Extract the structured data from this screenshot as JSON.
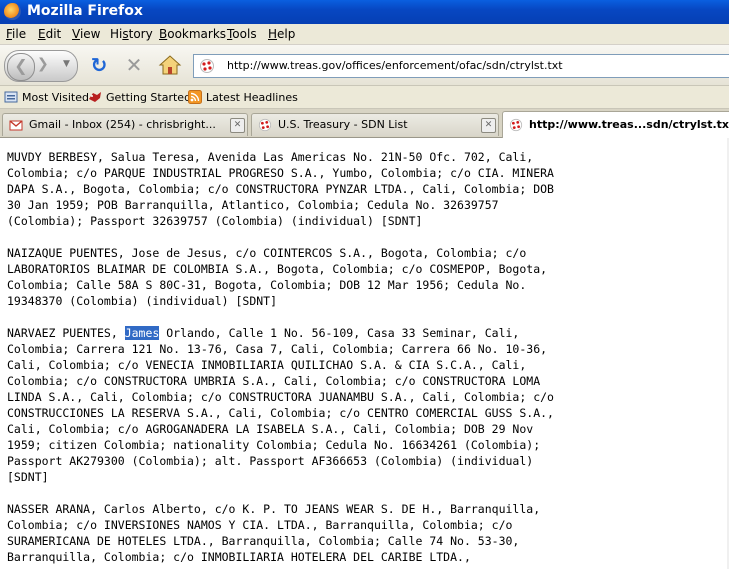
{
  "window": {
    "title": "Mozilla Firefox"
  },
  "menu": [
    "File",
    "Edit",
    "View",
    "History",
    "Bookmarks",
    "Tools",
    "Help"
  ],
  "menu_underline": [
    "F",
    "E",
    "V",
    "s",
    "B",
    "T",
    "H"
  ],
  "address": {
    "url": "http://www.treas.gov/offices/enforcement/ofac/sdn/ctrylst.txt"
  },
  "bookmarks": [
    {
      "label": "Most Visited",
      "icon": "most-visited-icon"
    },
    {
      "label": "Getting Started",
      "icon": "getting-started-icon"
    },
    {
      "label": "Latest Headlines",
      "icon": "rss-feed-icon"
    }
  ],
  "tabs": [
    {
      "label": "Gmail - Inbox (254) - chrisbright...",
      "icon": "gmail-icon",
      "active": false
    },
    {
      "label": "U.S. Treasury - SDN List",
      "icon": "treasury-favicon-icon",
      "active": false
    },
    {
      "label": "http://www.treas...sdn/ctrylst.txt",
      "icon": "treasury-favicon-icon",
      "active": true
    }
  ],
  "content": {
    "entries": [
      [
        "MUVDY BERBESY, Salua Teresa, Avenida Las Americas No. 21N-50 Ofc. 702, Cali,",
        "Colombia; c/o PARQUE INDUSTRIAL PROGRESO S.A., Yumbo, Colombia; c/o CIA. MINERA",
        "DAPA S.A., Bogota, Colombia; c/o CONSTRUCTORA PYNZAR LTDA., Cali, Colombia; DOB",
        "30 Jan 1959; POB Barranquilla, Atlantico, Colombia; Cedula No. 32639757",
        "(Colombia); Passport 32639757 (Colombia) (individual) [SDNT]"
      ],
      [
        "NAIZAQUE PUENTES, Jose de Jesus, c/o COINTERCOS S.A., Bogota, Colombia; c/o",
        "LABORATORIOS BLAIMAR DE COLOMBIA S.A., Bogota, Colombia; c/o COSMEPOP, Bogota,",
        "Colombia; Calle 58A S 80C-31, Bogota, Colombia; DOB 12 Mar 1956; Cedula No.",
        "19348370 (Colombia) (individual) [SDNT]"
      ],
      [
        "NARVAEZ PUENTES, James Orlando, Calle 1 No. 56-109, Casa 33 Seminar, Cali,",
        "Colombia; Carrera 121 No. 13-76, Casa 7, Cali, Colombia; Carrera 66 No. 10-36,",
        "Cali, Colombia; c/o VENECIA INMOBILIARIA QUILICHAO S.A. & CIA S.C.A., Cali,",
        "Colombia; c/o CONSTRUCTORA UMBRIA S.A., Cali, Colombia; c/o CONSTRUCTORA LOMA",
        "LINDA S.A., Cali, Colombia; c/o CONSTRUCTORA JUANAMBU S.A., Cali, Colombia; c/o",
        "CONSTRUCCIONES LA RESERVA S.A., Cali, Colombia; c/o CENTRO COMERCIAL GUSS S.A.,",
        "Cali, Colombia; c/o AGROGANADERA LA ISABELA S.A., Cali, Colombia; DOB 29 Nov",
        "1959; citizen Colombia; nationality Colombia; Cedula No. 16634261 (Colombia);",
        "Passport AK279300 (Colombia); alt. Passport AF366653 (Colombia) (individual)",
        "[SDNT]"
      ],
      [
        "NASSER ARANA, Carlos Alberto, c/o K. P. TO JEANS WEAR S. DE H., Barranquilla,",
        "Colombia; c/o INVERSIONES NAMOS Y CIA. LTDA., Barranquilla, Colombia; c/o",
        "SURAMERICANA DE HOTELES LTDA., Barranquilla, Colombia; Calle 74 No. 53-30,",
        "Barranquilla, Colombia; c/o INMOBILIARIA HOTELERA DEL CARIBE LTDA.,"
      ]
    ],
    "selection": {
      "entry": 2,
      "line": 0,
      "text": "James"
    }
  }
}
